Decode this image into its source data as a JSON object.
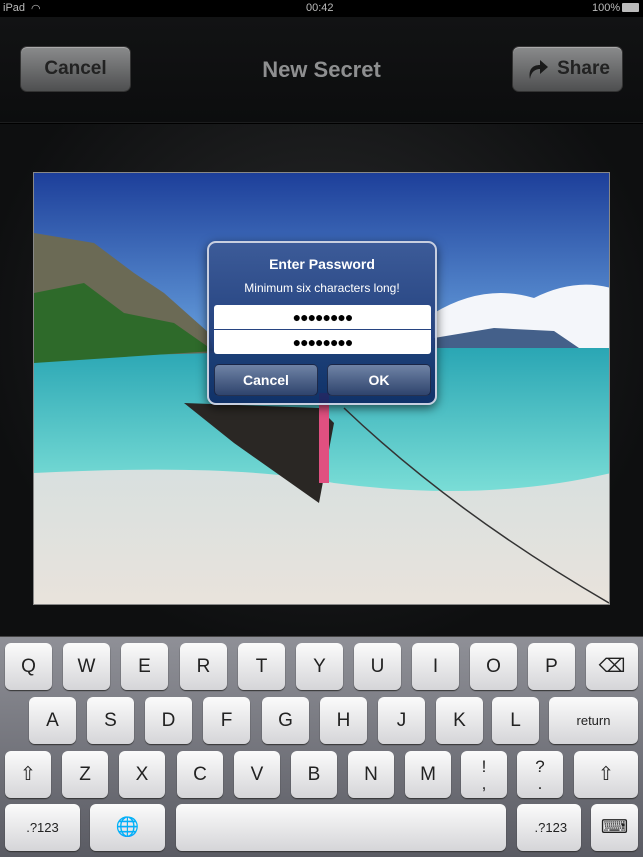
{
  "status": {
    "device": "iPad",
    "time": "00:42",
    "battery": "100%"
  },
  "navbar": {
    "cancel_label": "Cancel",
    "title": "New Secret",
    "share_label": "Share",
    "share_icon": "share-arrow-icon"
  },
  "alert": {
    "title": "Enter Password",
    "message": "Minimum six characters long!",
    "password1": "●●●●●●●●",
    "password2": "●●●●●●●●",
    "cancel_label": "Cancel",
    "ok_label": "OK"
  },
  "keyboard": {
    "rows": [
      [
        "Q",
        "W",
        "E",
        "R",
        "T",
        "Y",
        "U",
        "I",
        "O",
        "P",
        "⌫"
      ],
      [
        "A",
        "S",
        "D",
        "F",
        "G",
        "H",
        "J",
        "K",
        "L",
        "return"
      ],
      [
        "⇧",
        "Z",
        "X",
        "C",
        "V",
        "B",
        "N",
        "M",
        "!\n,",
        "?\n.",
        "⇧"
      ],
      [
        ".?123",
        "🌐",
        "",
        " .?123",
        "⌨"
      ]
    ]
  }
}
